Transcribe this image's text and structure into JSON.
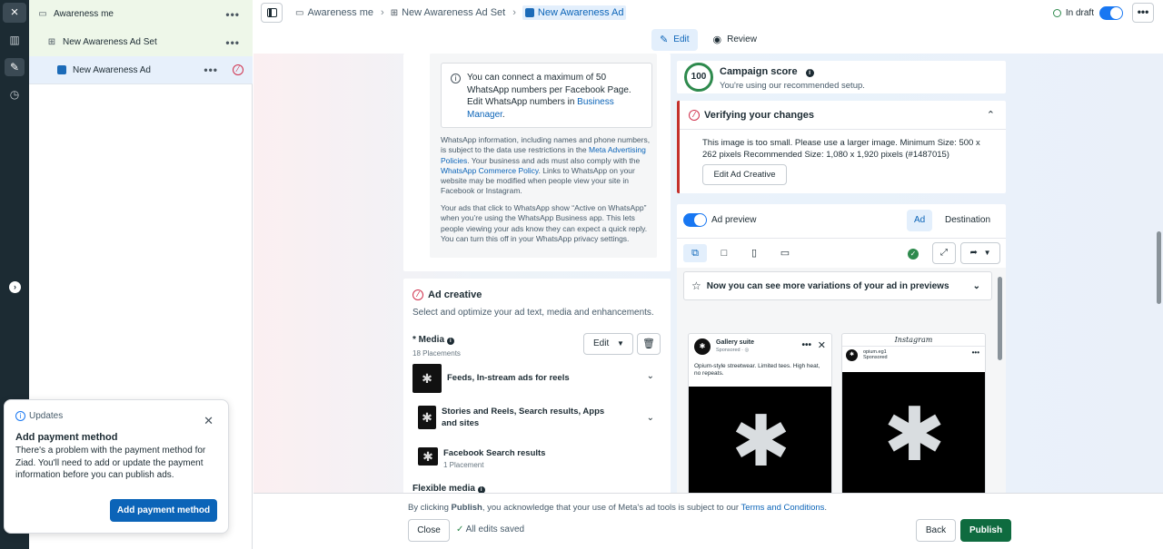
{
  "rail": {
    "close_icon": "×",
    "items": [
      "chart-icon",
      "pencil-icon",
      "clock-icon"
    ],
    "expand_icon": "›"
  },
  "tree": {
    "campaign": {
      "label": "Awareness me",
      "more": "•••"
    },
    "adset": {
      "label": "New Awareness Ad Set",
      "more": "•••"
    },
    "ad": {
      "label": "New Awareness Ad",
      "more": "•••"
    }
  },
  "toast": {
    "heading": "Updates",
    "title": "Add payment method",
    "body": "There's a problem with the payment method for Ziad. You'll need to add or update the payment information before you can publish ads.",
    "button": "Add payment method"
  },
  "topbar": {
    "breadcrumbs": [
      "Awareness me",
      "New Awareness Ad Set",
      "New Awareness Ad"
    ],
    "status": "In draft",
    "more": "•••"
  },
  "tabs": {
    "edit": "Edit",
    "review": "Review"
  },
  "whatsapp": {
    "note_text": "You can connect a maximum of 50 WhatsApp numbers per Facebook Page. Edit WhatsApp numbers in",
    "note_link": "Business Manager",
    "note_end": ".",
    "info_1": "WhatsApp information, including names and phone numbers, is subject to the data use restrictions in the",
    "info_1_link": "Meta Advertising Policies",
    "info_2": ". Your business and ads must also comply with the",
    "info_2_link": "WhatsApp Commerce Policy",
    "info_3": ". Links to WhatsApp on your website may be modified when people view your site in Facebook or Instagram.",
    "info_4": "Your ads that click to WhatsApp show “Active on WhatsApp” when you’re using the WhatsApp Business app. This lets people viewing your ads know they can expect a quick reply. You can turn this off in your WhatsApp privacy settings."
  },
  "creative": {
    "title": "Ad creative",
    "subtitle": "Select and optimize your ad text, media and enhancements.",
    "media_label": "* Media",
    "media_count": "18 Placements",
    "edit_label": "Edit",
    "placements": [
      {
        "name": "Feeds, In-stream ads for reels",
        "sub": ""
      },
      {
        "name": "Stories and Reels, Search results, Apps and sites",
        "sub": ""
      },
      {
        "name": "Facebook Search results",
        "sub": "1 Placement"
      }
    ],
    "flexible": "Flexible media"
  },
  "score": {
    "value": "100",
    "title": "Campaign score",
    "subtitle": "You're using our recommended setup."
  },
  "verify": {
    "title": "Verifying your changes",
    "text": "This image is too small. Please use a larger image. Minimum Size: 500 x 262 pixels Recommended Size: 1,080 x 1,920 pixels (#1487015)",
    "button": "Edit Ad Creative"
  },
  "preview": {
    "label": "Ad preview",
    "tab_ad": "Ad",
    "tab_destination": "Destination",
    "variations": "Now you can see more variations of your ad in previews",
    "fb": {
      "page": "Gallery suite",
      "sponsored": "Sponsored · ◎",
      "caption": "Opium-style streetwear. Limited tees. High heat, no repeats."
    },
    "ig": {
      "brand": "Instagram",
      "user": "opium.eg1",
      "sponsored": "Sponsored"
    }
  },
  "footer": {
    "legal_pre": "By clicking ",
    "legal_bold": "Publish",
    "legal_mid": ", you acknowledge that your use of Meta's ad tools is subject to our ",
    "legal_link": "Terms and Conditions",
    "legal_end": ".",
    "close": "Close",
    "saved": "All edits saved",
    "back": "Back",
    "publish": "Publish"
  }
}
